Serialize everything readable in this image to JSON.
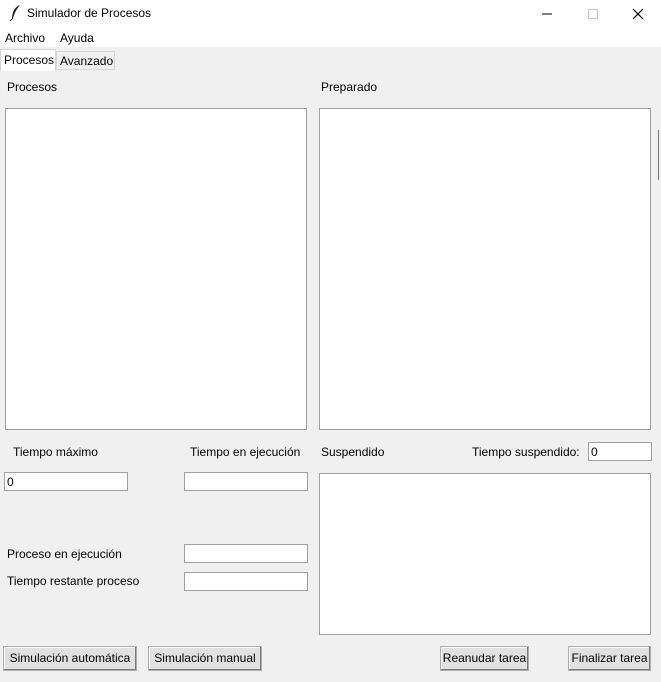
{
  "window": {
    "title": "Simulador de Procesos",
    "icon": "feather-icon",
    "controls": [
      "minimize-icon",
      "maximize-icon",
      "close-icon"
    ]
  },
  "menu": {
    "items": [
      {
        "label": "Archivo"
      },
      {
        "label": "Ayuda"
      }
    ]
  },
  "tabs": [
    {
      "label": "Procesos",
      "active": true
    },
    {
      "label": "Avanzado",
      "active": false
    }
  ],
  "panels": {
    "procesos_label": "Procesos",
    "preparado_label": "Preparado",
    "suspendido_label": "Suspendido"
  },
  "fields": {
    "tiempo_maximo_label": "Tiempo máximo",
    "tiempo_maximo_value": "0",
    "tiempo_ejecucion_label": "Tiempo en ejecución",
    "tiempo_ejecucion_value": "",
    "tiempo_suspendido_label": "Tiempo suspendido:",
    "tiempo_suspendido_value": "0",
    "proceso_ejecucion_label": "Proceso en ejecución",
    "proceso_ejecucion_value": "",
    "tiempo_restante_label": "Tiempo restante proceso",
    "tiempo_restante_value": ""
  },
  "buttons": {
    "simulacion_automatica": "Simulación automática",
    "simulacion_manual": "Simulación manual",
    "reanudar_tarea": "Reanudar tarea",
    "finalizar_tarea": "Finalizar tarea"
  }
}
